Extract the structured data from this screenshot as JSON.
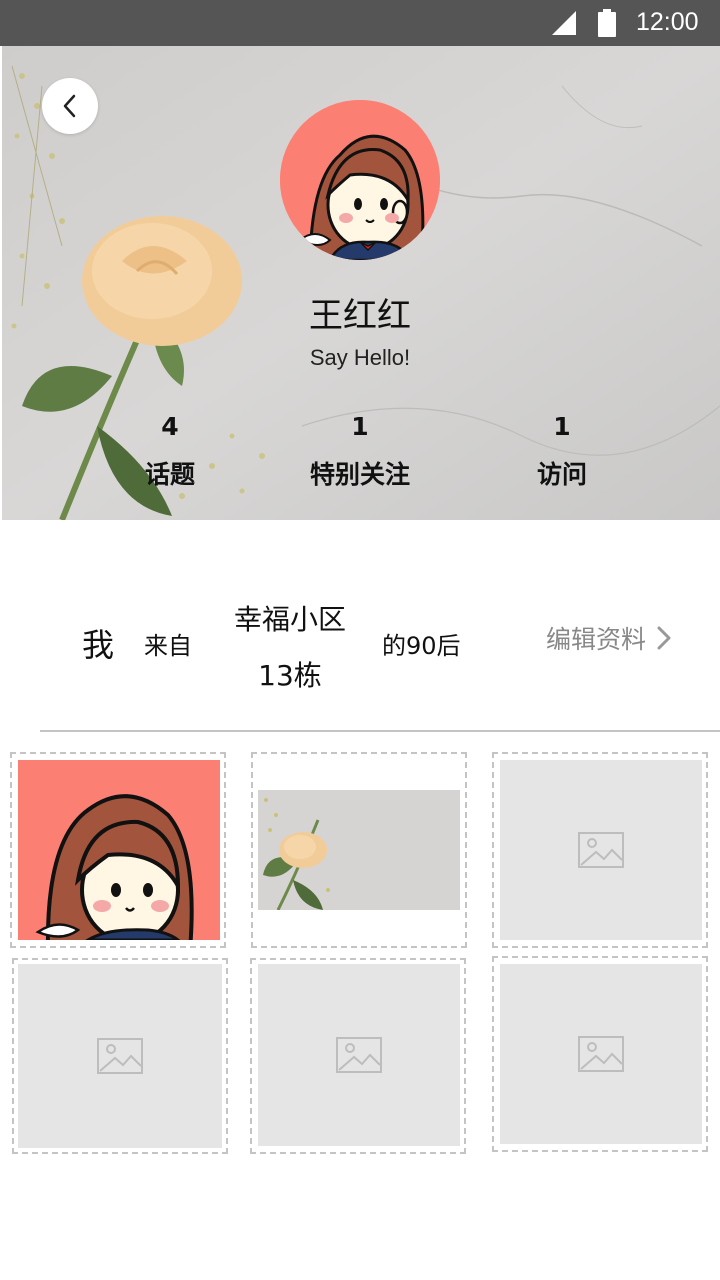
{
  "status_bar": {
    "time": "12:00"
  },
  "profile": {
    "name": "王红红",
    "bio": "Say Hello!",
    "stats": [
      {
        "value": "4",
        "label": "话题"
      },
      {
        "value": "1",
        "label": "特别关注"
      },
      {
        "value": "1",
        "label": "访问"
      }
    ]
  },
  "intro": {
    "me": "我",
    "from": "来自",
    "place_line1": "幸福小区",
    "place_line2": "13栋",
    "generation": "的90后",
    "edit_label": "编辑资料"
  },
  "gallery": [
    {
      "type": "avatar-image"
    },
    {
      "type": "flower-image"
    },
    {
      "type": "placeholder"
    },
    {
      "type": "placeholder"
    },
    {
      "type": "placeholder"
    },
    {
      "type": "placeholder"
    }
  ],
  "colors": {
    "status_bar": "#555555",
    "avatar_bg": "#fb7f72",
    "placeholder_bg": "#e5e5e5",
    "muted_text": "#888888"
  }
}
